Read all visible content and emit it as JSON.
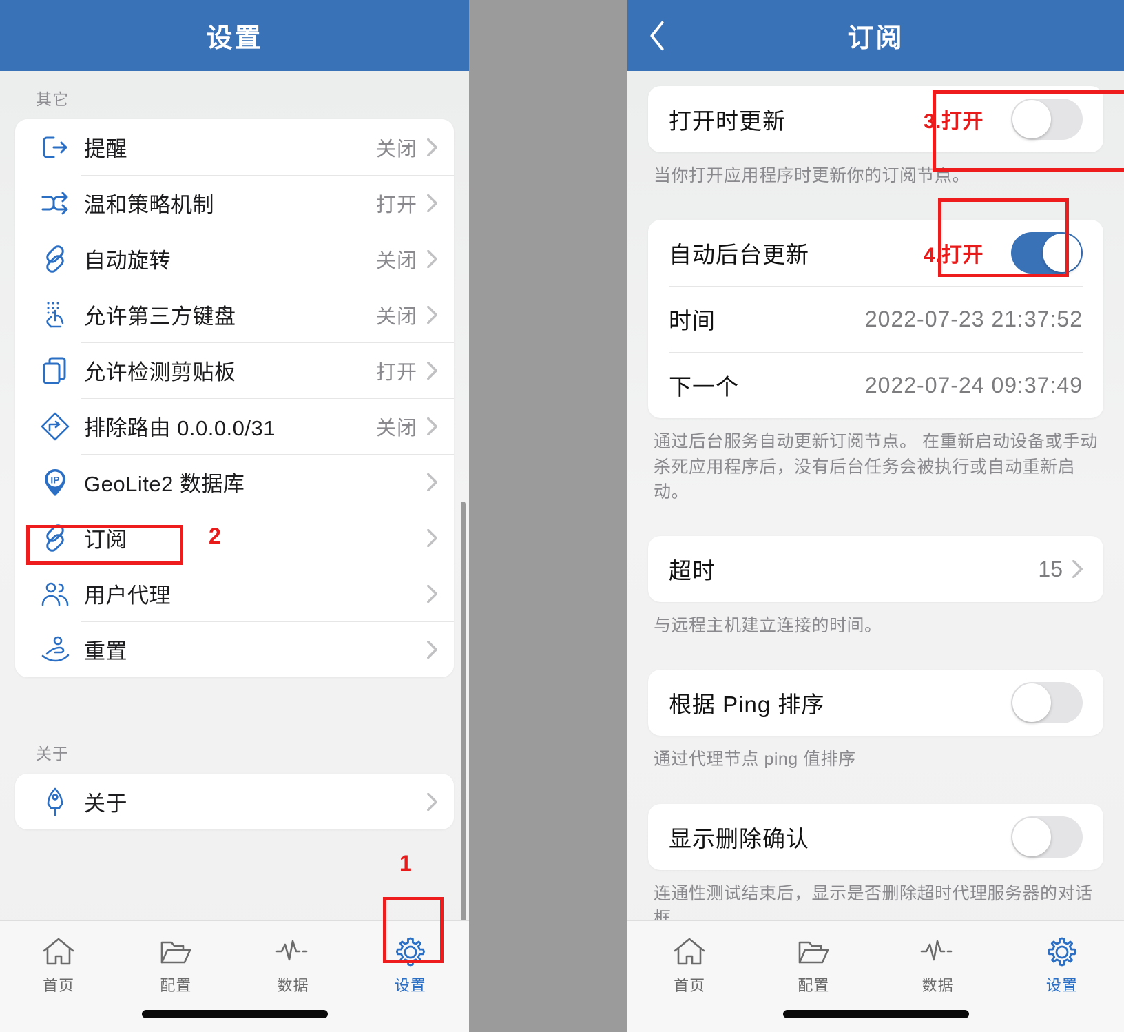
{
  "left_phone": {
    "nav": {
      "title": "设置"
    },
    "sections": [
      {
        "header": "其它",
        "items": [
          {
            "icon": "logout-icon",
            "label": "提醒",
            "value": "关闭"
          },
          {
            "icon": "shuffle-icon",
            "label": "温和策略机制",
            "value": "打开"
          },
          {
            "icon": "link-icon",
            "label": "自动旋转",
            "value": "关闭"
          },
          {
            "icon": "touch-keyboard-icon",
            "label": "允许第三方键盘",
            "value": "关闭"
          },
          {
            "icon": "clipboard-icon",
            "label": "允许检测剪贴板",
            "value": "打开"
          },
          {
            "icon": "route-icon",
            "label": "排除路由 0.0.0.0/31",
            "value": "关闭"
          },
          {
            "icon": "ip-pin-icon",
            "label": "GeoLite2 数据库",
            "value": ""
          },
          {
            "icon": "link-icon",
            "label": "订阅",
            "value": ""
          },
          {
            "icon": "users-icon",
            "label": "用户代理",
            "value": ""
          },
          {
            "icon": "reset-hand-icon",
            "label": "重置",
            "value": ""
          }
        ]
      },
      {
        "header": "关于",
        "items": [
          {
            "icon": "rocket-icon",
            "label": "关于",
            "value": ""
          }
        ]
      }
    ],
    "tabs": [
      {
        "icon": "home-icon",
        "label": "首页",
        "active": false
      },
      {
        "icon": "folder-icon",
        "label": "配置",
        "active": false
      },
      {
        "icon": "pulse-icon",
        "label": "数据",
        "active": false
      },
      {
        "icon": "gear-icon",
        "label": "设置",
        "active": true
      }
    ],
    "annotations": [
      {
        "id": "1",
        "target": "tab-settings"
      },
      {
        "id": "2",
        "target": "row-subscription"
      }
    ]
  },
  "right_phone": {
    "nav": {
      "title": "订阅",
      "back_icon": "back-chevron-icon"
    },
    "rows": {
      "update_on_open": {
        "label": "打开时更新",
        "annotation": "3.打开",
        "toggle": "off",
        "desc": "当你打开应用程序时更新你的订阅节点。"
      },
      "auto_background": {
        "label": "自动后台更新",
        "annotation": "4.打开",
        "toggle": "on"
      },
      "time": {
        "label": "时间",
        "value": "2022-07-23 21:37:52"
      },
      "next": {
        "label": "下一个",
        "value": "2022-07-24 09:37:49"
      },
      "background_desc": "通过后台服务自动更新订阅节点。 在重新启动设备或手动杀死应用程序后，没有后台任务会被执行或自动重新启动。",
      "timeout": {
        "label": "超时",
        "value": "15",
        "desc": "与远程主机建立连接的时间。"
      },
      "sort_by_ping": {
        "label": "根据 Ping 排序",
        "toggle": "off",
        "desc": "通过代理节点 ping 值排序"
      },
      "show_delete_confirm": {
        "label": "显示删除确认",
        "toggle": "off",
        "desc": "连通性测试结束后，显示是否删除超时代理服务器的对话框。"
      }
    },
    "tabs": [
      {
        "icon": "home-icon",
        "label": "首页",
        "active": false
      },
      {
        "icon": "folder-icon",
        "label": "配置",
        "active": false
      },
      {
        "icon": "pulse-icon",
        "label": "数据",
        "active": false
      },
      {
        "icon": "gear-icon",
        "label": "设置",
        "active": true
      }
    ]
  },
  "colors": {
    "nav_blue": "#3a72b8",
    "accent_blue": "#2a6fc4",
    "annotation_red": "#ee1c1c",
    "toggle_on": "#3a72b8",
    "toggle_off": "#e4e4e6",
    "gutter_gray": "#9b9b9b"
  }
}
